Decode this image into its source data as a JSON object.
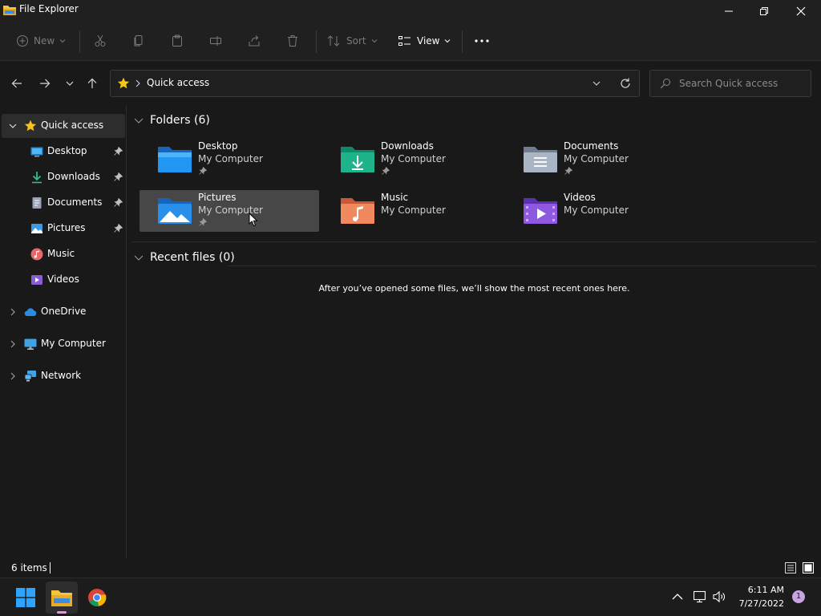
{
  "window": {
    "title": "File Explorer"
  },
  "commandbar": {
    "new_label": "New",
    "sort_label": "Sort",
    "view_label": "View"
  },
  "address": {
    "location": "Quick access",
    "search_placeholder": "Search Quick access"
  },
  "sidebar": {
    "quick_access": "Quick access",
    "items": [
      {
        "label": "Desktop",
        "icon": "desktop-icon",
        "pinned": true
      },
      {
        "label": "Downloads",
        "icon": "downloads-icon",
        "pinned": true
      },
      {
        "label": "Documents",
        "icon": "documents-icon",
        "pinned": true
      },
      {
        "label": "Pictures",
        "icon": "pictures-icon",
        "pinned": true
      },
      {
        "label": "Music",
        "icon": "music-icon",
        "pinned": false
      },
      {
        "label": "Videos",
        "icon": "videos-icon",
        "pinned": false
      }
    ],
    "onedrive": "OneDrive",
    "my_computer": "My Computer",
    "network": "Network"
  },
  "content": {
    "folders_header": "Folders (6)",
    "folders": [
      {
        "name": "Desktop",
        "location": "My Computer",
        "pinned": true,
        "icon": "desktop-folder-icon"
      },
      {
        "name": "Downloads",
        "location": "My Computer",
        "pinned": true,
        "icon": "downloads-folder-icon"
      },
      {
        "name": "Documents",
        "location": "My Computer",
        "pinned": true,
        "icon": "documents-folder-icon"
      },
      {
        "name": "Pictures",
        "location": "My Computer",
        "pinned": true,
        "icon": "pictures-folder-icon"
      },
      {
        "name": "Music",
        "location": "My Computer",
        "pinned": false,
        "icon": "music-folder-icon"
      },
      {
        "name": "Videos",
        "location": "My Computer",
        "pinned": false,
        "icon": "videos-folder-icon"
      }
    ],
    "recent_header": "Recent files (0)",
    "recent_empty_message": "After you’ve opened some files, we’ll show the most recent ones here."
  },
  "statusbar": {
    "item_count": "6 items"
  },
  "taskbar": {
    "time": "6:11 AM",
    "date": "7/27/2022",
    "notification_count": "1"
  },
  "colors": {
    "background": "#191919",
    "chrome": "#202020",
    "selected": "#2d2d2d",
    "hover_tile": "#474747",
    "star": "#f5c518",
    "accent_badge": "#c8a4e0"
  }
}
